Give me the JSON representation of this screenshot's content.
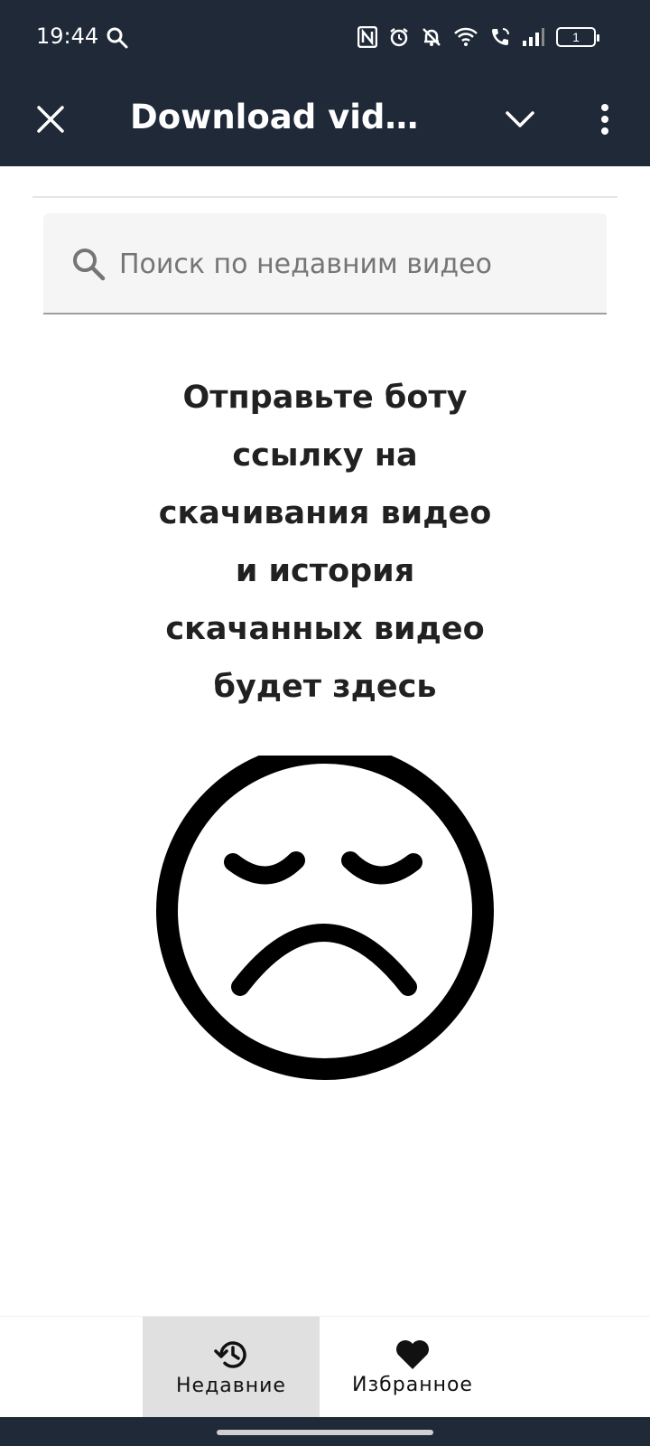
{
  "status_bar": {
    "time": "19:44",
    "icons": [
      "search-icon",
      "nfc-icon",
      "alarm-icon",
      "mute-icon",
      "wifi-icon",
      "wifi-calling-icon",
      "signal-icon"
    ],
    "battery": "1"
  },
  "app_bar": {
    "title": "Download videos…",
    "close_icon": "close-icon",
    "collapse_icon": "chevron-down-icon",
    "menu_icon": "more-vert-icon",
    "background": "#1f2937"
  },
  "search": {
    "placeholder": "Поиск по недавним видео",
    "value": ""
  },
  "empty_state": {
    "lines": [
      "Отправьте боту",
      "ссылку на",
      "скачивания видео",
      "и история",
      "скачанных видео",
      "будет здесь"
    ],
    "illustration": "sad-face-icon"
  },
  "bottom_nav": {
    "items": [
      {
        "label": "Недавние",
        "icon": "history-icon",
        "active": true
      },
      {
        "label": "Избранное",
        "icon": "heart-icon",
        "active": false
      }
    ]
  }
}
